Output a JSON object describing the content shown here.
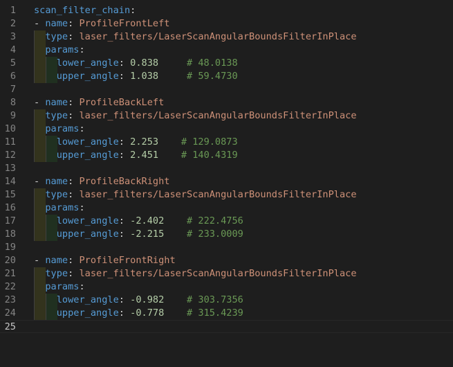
{
  "editor": {
    "top_fragment": "‐‐‐‐‐‐‐‐‐‐‐‐",
    "lines": [
      {
        "n": "1",
        "indent": 0,
        "parts": [
          {
            "t": "scan_filter_chain",
            "c": "key"
          },
          {
            "t": ":",
            "c": "punc"
          }
        ]
      },
      {
        "n": "2",
        "indent": 0,
        "parts": [
          {
            "t": "- ",
            "c": "punc"
          },
          {
            "t": "name",
            "c": "key"
          },
          {
            "t": ": ",
            "c": "punc"
          },
          {
            "t": "ProfileFrontLeft",
            "c": "str"
          }
        ]
      },
      {
        "n": "3",
        "indent": 1,
        "parts": [
          {
            "t": "  ",
            "c": "punc"
          },
          {
            "t": "type",
            "c": "key"
          },
          {
            "t": ": ",
            "c": "punc"
          },
          {
            "t": "laser_filters/LaserScanAngularBoundsFilterInPlace",
            "c": "str"
          }
        ]
      },
      {
        "n": "4",
        "indent": 1,
        "parts": [
          {
            "t": "  ",
            "c": "punc"
          },
          {
            "t": "params",
            "c": "key"
          },
          {
            "t": ":",
            "c": "punc"
          }
        ]
      },
      {
        "n": "5",
        "indent": 2,
        "parts": [
          {
            "t": "    ",
            "c": "punc"
          },
          {
            "t": "lower_angle",
            "c": "key"
          },
          {
            "t": ": ",
            "c": "punc"
          },
          {
            "t": "0.838",
            "c": "num"
          },
          {
            "t": "     ",
            "c": "punc"
          },
          {
            "t": "# 48.0138",
            "c": "cmt"
          }
        ]
      },
      {
        "n": "6",
        "indent": 2,
        "parts": [
          {
            "t": "    ",
            "c": "punc"
          },
          {
            "t": "upper_angle",
            "c": "key"
          },
          {
            "t": ": ",
            "c": "punc"
          },
          {
            "t": "1.038",
            "c": "num"
          },
          {
            "t": "     ",
            "c": "punc"
          },
          {
            "t": "# 59.4730",
            "c": "cmt"
          }
        ]
      },
      {
        "n": "7",
        "indent": 0,
        "parts": []
      },
      {
        "n": "8",
        "indent": 0,
        "parts": [
          {
            "t": "- ",
            "c": "punc"
          },
          {
            "t": "name",
            "c": "key"
          },
          {
            "t": ": ",
            "c": "punc"
          },
          {
            "t": "ProfileBackLeft",
            "c": "str"
          }
        ]
      },
      {
        "n": "9",
        "indent": 1,
        "parts": [
          {
            "t": "  ",
            "c": "punc"
          },
          {
            "t": "type",
            "c": "key"
          },
          {
            "t": ": ",
            "c": "punc"
          },
          {
            "t": "laser_filters/LaserScanAngularBoundsFilterInPlace",
            "c": "str"
          }
        ]
      },
      {
        "n": "10",
        "indent": 1,
        "parts": [
          {
            "t": "  ",
            "c": "punc"
          },
          {
            "t": "params",
            "c": "key"
          },
          {
            "t": ":",
            "c": "punc"
          }
        ]
      },
      {
        "n": "11",
        "indent": 2,
        "parts": [
          {
            "t": "    ",
            "c": "punc"
          },
          {
            "t": "lower_angle",
            "c": "key"
          },
          {
            "t": ": ",
            "c": "punc"
          },
          {
            "t": "2.253",
            "c": "num"
          },
          {
            "t": "    ",
            "c": "punc"
          },
          {
            "t": "# 129.0873",
            "c": "cmt"
          }
        ]
      },
      {
        "n": "12",
        "indent": 2,
        "parts": [
          {
            "t": "    ",
            "c": "punc"
          },
          {
            "t": "upper_angle",
            "c": "key"
          },
          {
            "t": ": ",
            "c": "punc"
          },
          {
            "t": "2.451",
            "c": "num"
          },
          {
            "t": "    ",
            "c": "punc"
          },
          {
            "t": "# 140.4319",
            "c": "cmt"
          }
        ]
      },
      {
        "n": "13",
        "indent": 0,
        "parts": []
      },
      {
        "n": "14",
        "indent": 0,
        "parts": [
          {
            "t": "- ",
            "c": "punc"
          },
          {
            "t": "name",
            "c": "key"
          },
          {
            "t": ": ",
            "c": "punc"
          },
          {
            "t": "ProfileBackRight",
            "c": "str"
          }
        ]
      },
      {
        "n": "15",
        "indent": 1,
        "parts": [
          {
            "t": "  ",
            "c": "punc"
          },
          {
            "t": "type",
            "c": "key"
          },
          {
            "t": ": ",
            "c": "punc"
          },
          {
            "t": "laser_filters/LaserScanAngularBoundsFilterInPlace",
            "c": "str"
          }
        ]
      },
      {
        "n": "16",
        "indent": 1,
        "parts": [
          {
            "t": "  ",
            "c": "punc"
          },
          {
            "t": "params",
            "c": "key"
          },
          {
            "t": ":",
            "c": "punc"
          }
        ]
      },
      {
        "n": "17",
        "indent": 2,
        "parts": [
          {
            "t": "    ",
            "c": "punc"
          },
          {
            "t": "lower_angle",
            "c": "key"
          },
          {
            "t": ": ",
            "c": "punc"
          },
          {
            "t": "-2.402",
            "c": "num"
          },
          {
            "t": "    ",
            "c": "punc"
          },
          {
            "t": "# 222.4756",
            "c": "cmt"
          }
        ]
      },
      {
        "n": "18",
        "indent": 2,
        "parts": [
          {
            "t": "    ",
            "c": "punc"
          },
          {
            "t": "upper_angle",
            "c": "key"
          },
          {
            "t": ": ",
            "c": "punc"
          },
          {
            "t": "-2.215",
            "c": "num"
          },
          {
            "t": "    ",
            "c": "punc"
          },
          {
            "t": "# 233.0009",
            "c": "cmt"
          }
        ]
      },
      {
        "n": "19",
        "indent": 0,
        "parts": []
      },
      {
        "n": "20",
        "indent": 0,
        "parts": [
          {
            "t": "- ",
            "c": "punc"
          },
          {
            "t": "name",
            "c": "key"
          },
          {
            "t": ": ",
            "c": "punc"
          },
          {
            "t": "ProfileFrontRight",
            "c": "str"
          }
        ]
      },
      {
        "n": "21",
        "indent": 1,
        "parts": [
          {
            "t": "  ",
            "c": "punc"
          },
          {
            "t": "type",
            "c": "key"
          },
          {
            "t": ": ",
            "c": "punc"
          },
          {
            "t": "laser_filters/LaserScanAngularBoundsFilterInPlace",
            "c": "str"
          }
        ]
      },
      {
        "n": "22",
        "indent": 1,
        "parts": [
          {
            "t": "  ",
            "c": "punc"
          },
          {
            "t": "params",
            "c": "key"
          },
          {
            "t": ":",
            "c": "punc"
          }
        ]
      },
      {
        "n": "23",
        "indent": 2,
        "parts": [
          {
            "t": "    ",
            "c": "punc"
          },
          {
            "t": "lower_angle",
            "c": "key"
          },
          {
            "t": ": ",
            "c": "punc"
          },
          {
            "t": "-0.982",
            "c": "num"
          },
          {
            "t": "    ",
            "c": "punc"
          },
          {
            "t": "# 303.7356",
            "c": "cmt"
          }
        ]
      },
      {
        "n": "24",
        "indent": 2,
        "parts": [
          {
            "t": "    ",
            "c": "punc"
          },
          {
            "t": "upper_angle",
            "c": "key"
          },
          {
            "t": ": ",
            "c": "punc"
          },
          {
            "t": "-0.778",
            "c": "num"
          },
          {
            "t": "    ",
            "c": "punc"
          },
          {
            "t": "# 315.4239",
            "c": "cmt"
          }
        ]
      },
      {
        "n": "25",
        "indent": 0,
        "parts": [],
        "current": true
      }
    ]
  }
}
